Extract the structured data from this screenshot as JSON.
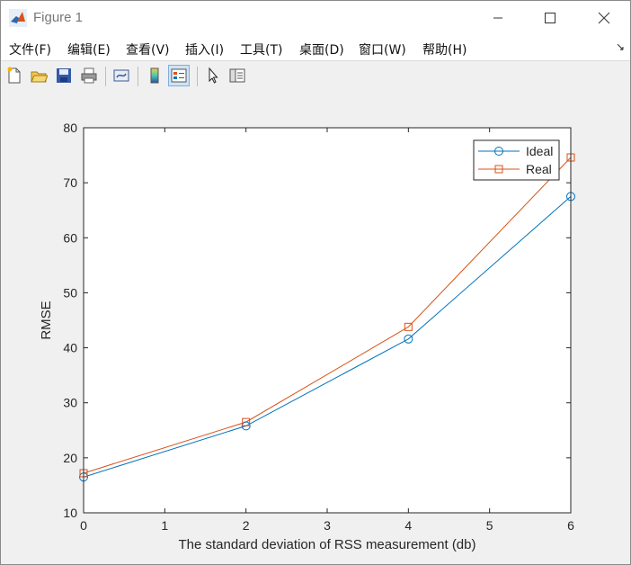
{
  "window": {
    "title": "Figure 1"
  },
  "menu": [
    {
      "label": "文件(F)"
    },
    {
      "label": "编辑(E)"
    },
    {
      "label": "查看(V)"
    },
    {
      "label": "插入(I)"
    },
    {
      "label": "工具(T)"
    },
    {
      "label": "桌面(D)"
    },
    {
      "label": "窗口(W)"
    },
    {
      "label": "帮助(H)"
    }
  ],
  "toolbar": {
    "buttons": [
      "new-figure-icon",
      "open-file-icon",
      "save-icon",
      "print-icon",
      "link-plot-icon",
      "insert-colorbar-icon",
      "insert-legend-icon",
      "edit-plot-icon",
      "property-inspector-icon"
    ]
  },
  "colors": {
    "ideal": "#0072bd",
    "real": "#d95319"
  },
  "chart_data": {
    "type": "line",
    "xlabel": "The standard deviation of RSS measurement (db)",
    "ylabel": "RMSE",
    "xlim": [
      0,
      6
    ],
    "ylim": [
      10,
      80
    ],
    "xticks": [
      "0",
      "1",
      "2",
      "3",
      "4",
      "5",
      "6"
    ],
    "yticks": [
      "10",
      "20",
      "30",
      "40",
      "50",
      "60",
      "70",
      "80"
    ],
    "x": [
      0,
      2,
      4,
      6
    ],
    "series": [
      {
        "name": "Ideal",
        "marker": "circle",
        "values": [
          16.5,
          25.8,
          41.6,
          67.5
        ]
      },
      {
        "name": "Real",
        "marker": "square",
        "values": [
          17.2,
          26.5,
          43.8,
          74.6
        ]
      }
    ],
    "legend": "top-right",
    "grid": false
  }
}
